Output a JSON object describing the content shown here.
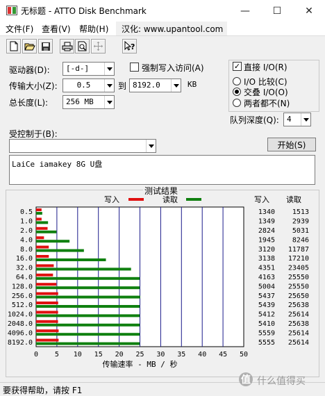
{
  "window": {
    "title": "无标题 - ATTO Disk Benchmark",
    "minimize_glyph": "—",
    "maximize_glyph": "☐",
    "close_glyph": "✕"
  },
  "menu": {
    "file": "文件(F)",
    "view": "查看(V)",
    "help": "帮助(H)",
    "localization": "汉化: www.upantool.com"
  },
  "toolbar": {
    "icons": [
      "new-icon",
      "open-icon",
      "save-icon",
      "print-icon",
      "print-preview-icon",
      "move-icon",
      "help-pointer-icon"
    ]
  },
  "form": {
    "drive_label": "驱动器(D):",
    "drive_value": "[-d-]",
    "force_write_label": "强制写入访问(A)",
    "transfer_label": "传输大小(Z):",
    "transfer_from": "0.5",
    "to_label": "到",
    "transfer_to": "8192.0",
    "kb_unit": "KB",
    "total_label": "总长度(L):",
    "total_value": "256 MB",
    "direct_io_label": "直接 I/O(R)",
    "direct_io_checked": true,
    "io_compare_label": "I/O 比较(C)",
    "overlapped_io_label": "交叠 I/O(O)",
    "neither_label": "两者都不(N)",
    "selected_io_mode": "overlapped",
    "queue_depth_label": "队列深度(Q):",
    "queue_depth_value": "4",
    "controlled_by_label": "受控制于(B):",
    "controlled_by_value": "",
    "start_button": "开始(S)",
    "description": "LaiCe iamakey 8G U盘"
  },
  "results": {
    "group_title": "测试结果",
    "write_legend": "写入",
    "read_legend": "读取",
    "write_col": "写入",
    "read_col": "读取"
  },
  "chart_data": {
    "type": "bar",
    "orientation": "horizontal",
    "xlabel": "传输速率 - MB / 秒",
    "xlim": [
      0,
      50
    ],
    "xticks": [
      0,
      5,
      10,
      15,
      20,
      25,
      30,
      35,
      40,
      45,
      50
    ],
    "categories": [
      "0.5",
      "1.0",
      "2.0",
      "4.0",
      "8.0",
      "16.0",
      "32.0",
      "64.0",
      "128.0",
      "256.0",
      "512.0",
      "1024.0",
      "2048.0",
      "4096.0",
      "8192.0"
    ],
    "series": [
      {
        "name": "写入",
        "color": "#e01010",
        "values": [
          1.31,
          1.32,
          2.76,
          1.9,
          3.05,
          3.06,
          4.25,
          4.07,
          4.89,
          5.31,
          5.31,
          5.29,
          5.28,
          5.43,
          5.42
        ]
      },
      {
        "name": "读取",
        "color": "#108010",
        "values": [
          1.48,
          2.87,
          4.91,
          8.05,
          11.51,
          16.81,
          22.86,
          24.95,
          24.95,
          25.05,
          24.94,
          24.94,
          24.94,
          24.94,
          24.94
        ]
      }
    ],
    "write_kbs": [
      "1340",
      "1349",
      "2824",
      "1945",
      "3120",
      "3138",
      "4351",
      "4163",
      "5004",
      "5437",
      "5439",
      "5412",
      "5410",
      "5559",
      "5555"
    ],
    "read_kbs": [
      "1513",
      "2939",
      "5031",
      "8246",
      "11787",
      "17210",
      "23405",
      "25550",
      "25550",
      "25650",
      "25638",
      "25614",
      "25638",
      "25614",
      "25614"
    ],
    "grid": true,
    "legend": "top"
  },
  "status": {
    "text": "要获得帮助，请按 F1"
  },
  "watermark": {
    "text": "什么值得买"
  }
}
